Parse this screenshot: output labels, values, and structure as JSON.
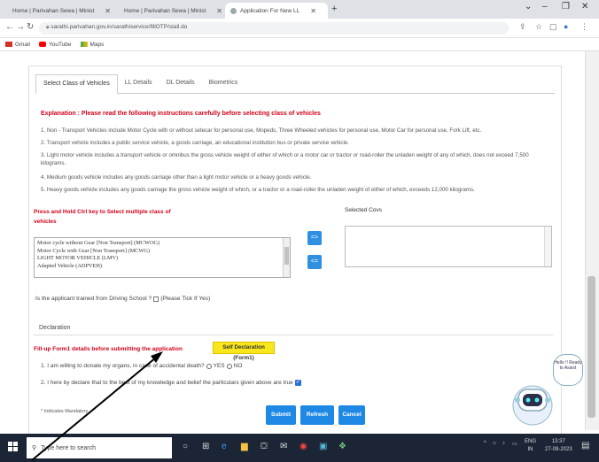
{
  "browser": {
    "tabs": [
      {
        "title": "Home | Parivahan Sewa | Minist",
        "active": false
      },
      {
        "title": "Home | Parivahan Sewa | Minist",
        "active": false
      },
      {
        "title": "Application For New LL",
        "active": true
      }
    ],
    "url": "sarathi.parivahan.gov.in/sarathiservice/fillOTP/stall.do",
    "bookmarks": [
      "Gmail",
      "YouTube",
      "Maps"
    ]
  },
  "form": {
    "tabs": [
      "Select Class of Vehicles",
      "LL Details",
      "DL Details",
      "Biometrics"
    ],
    "explanation_title": "Explanation : Please read the following instructions carefully before selecting class of vehicles",
    "rules": [
      "1. Non - Transport Vehicles include Motor Cycle with or without sidecar for personal use, Mopeds, Three Wheeled vehicles for personal use, Motor Car for personal use, Fork Lift, etc.",
      "2. Transport vehicle includes a public service vehicle, a goods carriage, an educational institution bus or private service vehicle.",
      "3. Light motor vehicle includes a transport vehicle or omnibus the gross vehicle weight of either of which or a motor car or tractor or road-roller the unladen weight of any of which, does not exceed 7,500 kilograms.",
      "4. Medium goods vehicle includes any goods carriage other than a light motor vehicle or a heavy goods vehicle.",
      "5. Heavy goods vehicle includes any goods carriage the gross vehicle weight of which, or a tractor or a road-roller the unladen weight of either of which, exceeds 12,000 kilograms."
    ],
    "press_label": "Press and Hold Ctrl key to Select multiple class of vehicles",
    "selected_label": "Selected Covs",
    "vehicle_options": [
      "Motor cycle without Gear [Non Transport] (MCWOG)",
      "Motor Cycle with Gear [Non Transport] (MCWG)",
      "LIGHT MOTOR VEHICLE (LMV)",
      "Adapted Vehicle (ADPVEH)"
    ],
    "move_right": "=>",
    "move_left": "<=",
    "trained_question": "Is the applicant trained from Driving School ?",
    "trained_hint": "(Please Tick If Yes)",
    "declaration_title": "Declaration",
    "fillup_text": "Fill-up Form1 details before submitting the application",
    "self_declaration": "Self Declaration (Form1)",
    "q1_text": "1. I am willing to donate my organs, in case of accidental death?",
    "q1_yes": "YES",
    "q1_no": "NO",
    "q2_text": "2. I here by declare that to the best of my knowledge and belief the particulars given above are true",
    "mandatory_note": "* Indicates Mandatory",
    "buttons": {
      "submit": "Submit",
      "refresh": "Refresh",
      "cancel": "Cancel"
    }
  },
  "chatbot": {
    "bubble": "Hello !! Ready to Assist"
  },
  "taskbar": {
    "search_placeholder": "Type here to search",
    "lang": "ENG",
    "region": "IN",
    "time": "13:37",
    "date": "27-09-2023"
  },
  "colors": {
    "accent": "#1e88e5",
    "alert": "#d0021b",
    "highlight": "#f8e71c",
    "taskbar": "#1b2535"
  }
}
